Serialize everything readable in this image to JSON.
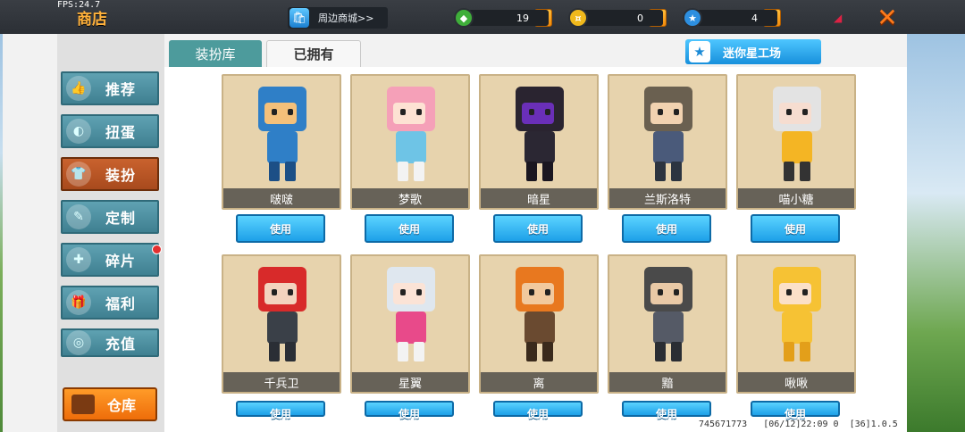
{
  "hud": {
    "fps": "FPS:24.7",
    "title": "商店",
    "mall_label": "周边商城>>",
    "currencies": [
      {
        "icon": "green-gem-icon",
        "value": "19",
        "color": "#3fae3a"
      },
      {
        "icon": "gold-coin-icon",
        "value": "0",
        "color": "#f0b91c"
      },
      {
        "icon": "blue-star-coin-icon",
        "value": "4",
        "color": "#2d8fe0"
      }
    ],
    "plus_label": "+",
    "close_label": "✕"
  },
  "sidebar": {
    "items": [
      {
        "label": "推荐",
        "icon": "thumbs-up-icon",
        "active": false,
        "dot": false
      },
      {
        "label": "扭蛋",
        "icon": "capsule-icon",
        "active": false,
        "dot": false
      },
      {
        "label": "装扮",
        "icon": "shirt-icon",
        "active": true,
        "dot": false
      },
      {
        "label": "定制",
        "icon": "pencil-icon",
        "active": false,
        "dot": false
      },
      {
        "label": "碎片",
        "icon": "puzzle-icon",
        "active": false,
        "dot": true
      },
      {
        "label": "福利",
        "icon": "gift-icon",
        "active": false,
        "dot": false
      },
      {
        "label": "充值",
        "icon": "coin-stack-icon",
        "active": false,
        "dot": false
      }
    ],
    "warehouse_label": "仓库"
  },
  "tabs": [
    {
      "label": "装扮库",
      "active": false
    },
    {
      "label": "已拥有",
      "active": true
    }
  ],
  "workshop_label": "迷你星工场",
  "use_label": "使用",
  "skins": [
    {
      "name": "啵啵",
      "head": "#2f7fc7",
      "face": "#f4c07a",
      "body": "#2f7fc7",
      "leg": "#1c4f86"
    },
    {
      "name": "梦歌",
      "head": "#f5a0b8",
      "face": "#fde2d3",
      "body": "#6ec4e6",
      "leg": "#f3f3f3"
    },
    {
      "name": "暗星",
      "head": "#2a2430",
      "face": "#6a2fb8",
      "body": "#2b2733",
      "leg": "#1a1620"
    },
    {
      "name": "兰斯洛特",
      "head": "#6a6050",
      "face": "#f1d2b0",
      "body": "#4a5a7a",
      "leg": "#2c3440"
    },
    {
      "name": "喵小糖",
      "head": "#e3e3e3",
      "face": "#f6ddd0",
      "body": "#f4b524",
      "leg": "#333"
    },
    {
      "name": "千兵卫",
      "head": "#d82a2a",
      "face": "#f3d3be",
      "body": "#3a4048",
      "leg": "#2a2e35"
    },
    {
      "name": "星翼",
      "head": "#dfe7ef",
      "face": "#fbe3d6",
      "body": "#e84a8a",
      "leg": "#f3f3f3"
    },
    {
      "name": "离",
      "head": "#e8781f",
      "face": "#f1c99e",
      "body": "#6a4a30",
      "leg": "#3a2a1c"
    },
    {
      "name": "黯",
      "head": "#4a4a4a",
      "face": "#e9c9a6",
      "body": "#555a66",
      "leg": "#2a2d33"
    },
    {
      "name": "啾啾",
      "head": "#f6c234",
      "face": "#fbe0c8",
      "body": "#f6c234",
      "leg": "#e39f1a"
    }
  ],
  "footer": "745671773   [06/12]22:09 0  [36]1.0.5"
}
